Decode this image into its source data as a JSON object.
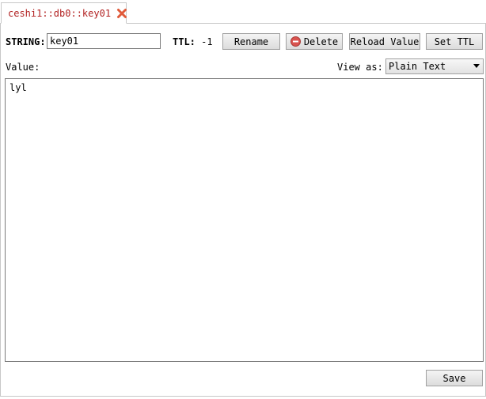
{
  "tab": {
    "label": "ceshi1::db0::key01",
    "close_icon": "close-x-icon",
    "label_color": "#b22222",
    "close_color": "#e05a3a"
  },
  "key_editor": {
    "type_label": "STRING:",
    "key_name": "key01",
    "ttl_label": "TTL:",
    "ttl_value": "-1",
    "rename_label": "Rename",
    "delete_label": "Delete",
    "delete_icon": "minus-circle-icon",
    "reload_label": "Reload Value",
    "set_ttl_label": "Set TTL"
  },
  "value_section": {
    "value_label": "Value:",
    "view_as_label": "View as:",
    "view_as_selected": "Plain Text",
    "value_text": "lyl"
  },
  "footer": {
    "save_label": "Save"
  }
}
